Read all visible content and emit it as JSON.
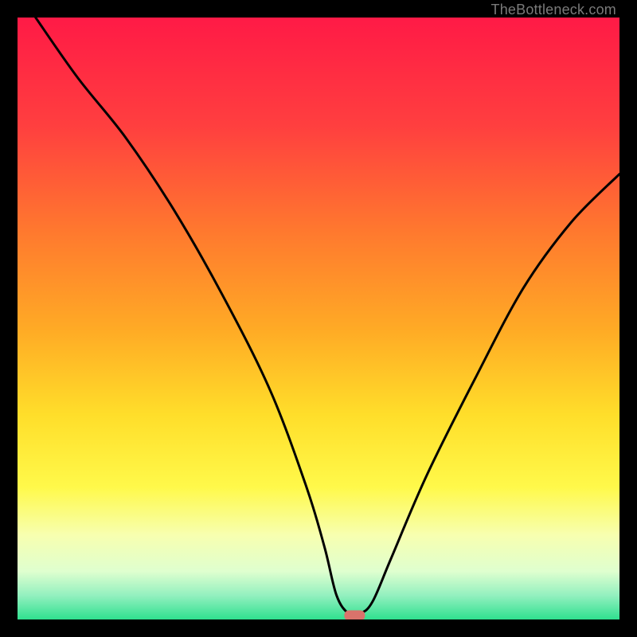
{
  "watermark": "TheBottleneck.com",
  "chart_data": {
    "type": "line",
    "title": "",
    "xlabel": "",
    "ylabel": "",
    "xlim": [
      0,
      100
    ],
    "ylim": [
      0,
      100
    ],
    "series": [
      {
        "name": "bottleneck-curve",
        "x": [
          3,
          10,
          18,
          26,
          34,
          42,
          48,
          51,
          53,
          55,
          57,
          59,
          62,
          68,
          76,
          84,
          92,
          100
        ],
        "y": [
          100,
          90,
          80,
          68,
          54,
          38,
          22,
          12,
          4,
          1,
          1,
          3,
          10,
          24,
          40,
          55,
          66,
          74
        ]
      }
    ],
    "marker": {
      "x": 56,
      "y": 0.6,
      "color": "#d9736b"
    },
    "background_gradient": {
      "stops": [
        {
          "offset": 0,
          "color": "#ff1a46"
        },
        {
          "offset": 0.18,
          "color": "#ff3f3f"
        },
        {
          "offset": 0.36,
          "color": "#ff7a2e"
        },
        {
          "offset": 0.52,
          "color": "#ffab25"
        },
        {
          "offset": 0.66,
          "color": "#ffde2a"
        },
        {
          "offset": 0.78,
          "color": "#fff94a"
        },
        {
          "offset": 0.86,
          "color": "#f7ffb0"
        },
        {
          "offset": 0.92,
          "color": "#dfffcf"
        },
        {
          "offset": 0.96,
          "color": "#93f0bf"
        },
        {
          "offset": 1.0,
          "color": "#2fe08f"
        }
      ]
    }
  }
}
